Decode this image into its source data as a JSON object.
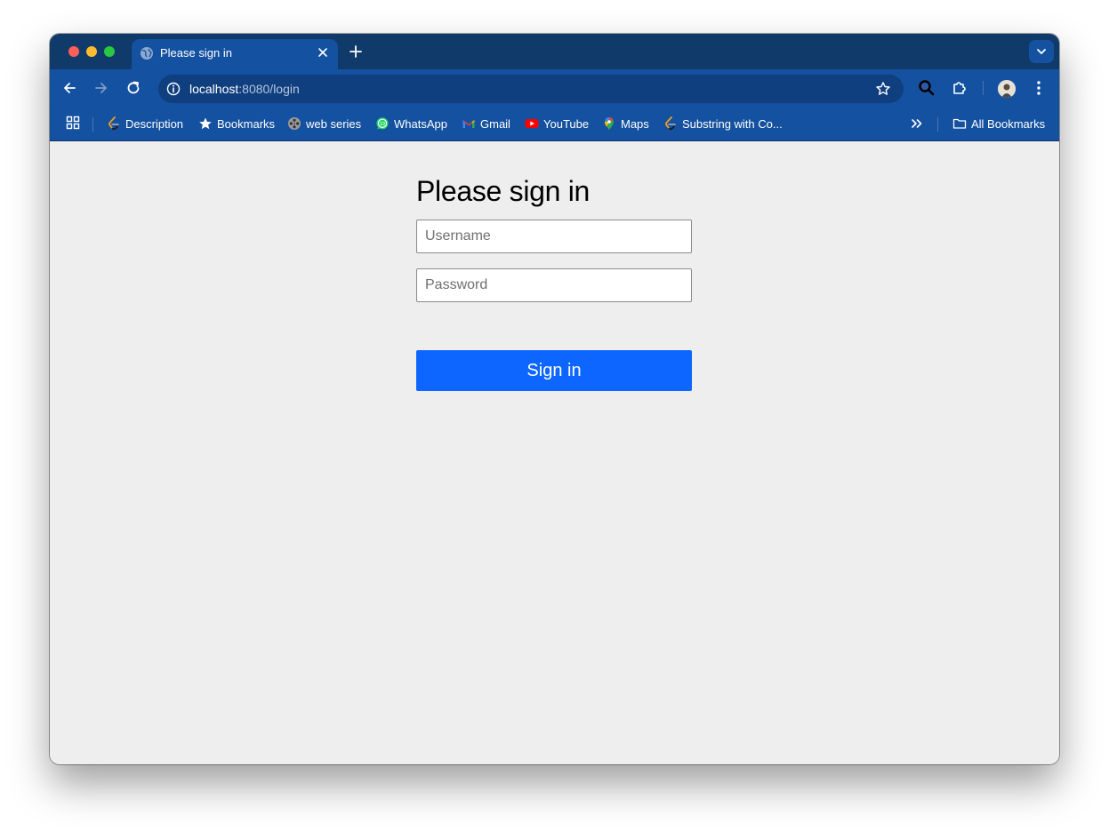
{
  "browser": {
    "tab": {
      "title": "Please sign in"
    },
    "toolbar": {
      "url_host": "localhost",
      "url_path": ":8080/login"
    },
    "bookmarks": [
      {
        "label": "Description",
        "icon": "leetcode-icon"
      },
      {
        "label": "Bookmarks",
        "icon": "star-icon"
      },
      {
        "label": "web series",
        "icon": "film-reel-icon"
      },
      {
        "label": "WhatsApp",
        "icon": "whatsapp-icon"
      },
      {
        "label": "Gmail",
        "icon": "gmail-icon"
      },
      {
        "label": "YouTube",
        "icon": "youtube-icon"
      },
      {
        "label": "Maps",
        "icon": "maps-icon"
      },
      {
        "label": "Substring with Co...",
        "icon": "leetcode-icon"
      }
    ],
    "all_bookmarks_label": "All Bookmarks",
    "colors": {
      "tabstrip": "#0f3a6a",
      "toolbar": "#1451a0",
      "omnibox": "#0f3f7f"
    }
  },
  "page": {
    "heading": "Please sign in",
    "username_placeholder": "Username",
    "password_placeholder": "Password",
    "signin_label": "Sign in",
    "colors": {
      "background": "#eeeeee",
      "button": "#0d66ff"
    }
  }
}
